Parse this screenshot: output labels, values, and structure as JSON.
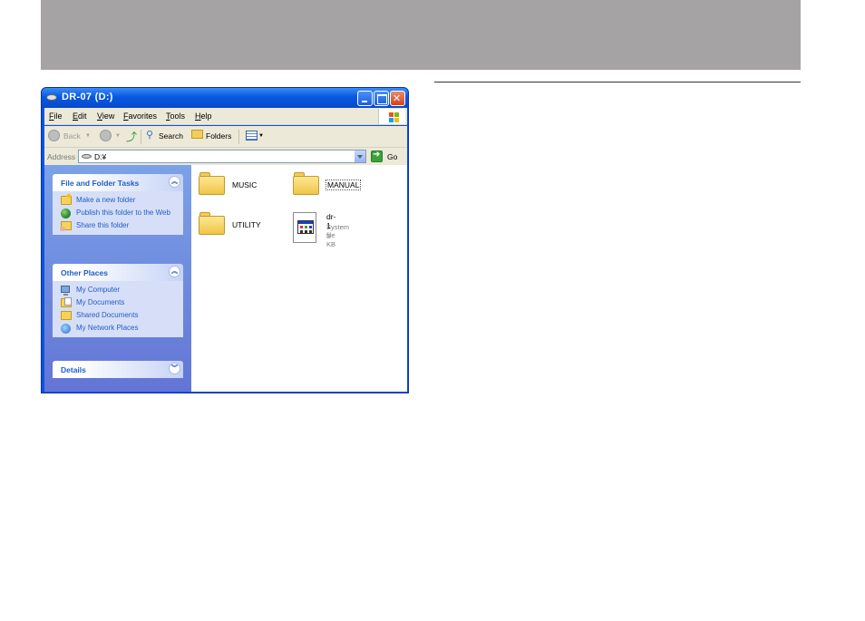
{
  "window": {
    "title": "DR-07 (D:)"
  },
  "menu": {
    "file": "File",
    "edit": "Edit",
    "view": "View",
    "favorites": "Favorites",
    "tools": "Tools",
    "help": "Help"
  },
  "toolbar": {
    "back": "Back",
    "search": "Search",
    "folders": "Folders"
  },
  "address": {
    "label": "Address",
    "value": "D:¥",
    "go": "Go"
  },
  "panels": {
    "tasks": {
      "title": "File and Folder Tasks",
      "items": [
        "Make a new folder",
        "Publish this folder to the Web",
        "Share this folder"
      ]
    },
    "places": {
      "title": "Other Places",
      "items": [
        "My Computer",
        "My Documents",
        "Shared Documents",
        "My Network Places"
      ]
    },
    "details": {
      "title": "Details"
    }
  },
  "content": {
    "folders": [
      "MUSIC",
      "MANUAL",
      "UTILITY"
    ],
    "file": {
      "name": "dr-1",
      "type": "System file",
      "size": "3 KB"
    }
  },
  "colors": {
    "titlebar": "#0858e0",
    "taskpane": "#7ba2e7",
    "link": "#215dc6",
    "band": "#a5a3a4"
  }
}
